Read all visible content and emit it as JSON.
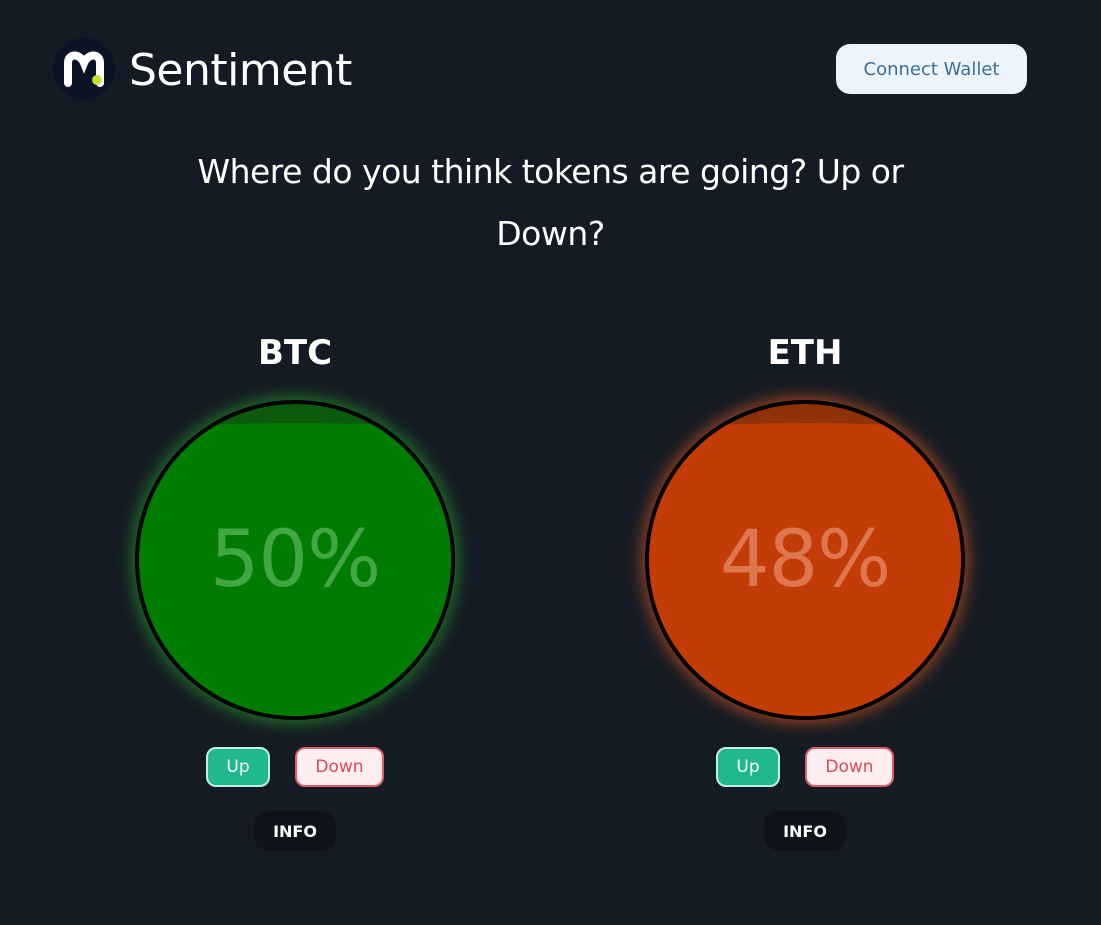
{
  "header": {
    "brand": "Sentiment",
    "logo_icon": "m-logo-icon",
    "connect_wallet_label": "Connect Wallet"
  },
  "question": "Where do you think tokens are going? Up or Down?",
  "tokens": [
    {
      "symbol": "BTC",
      "percent_label": "50%",
      "percent": 50,
      "color": "#007c00",
      "up_label": "Up",
      "down_label": "Down",
      "info_label": "INFO"
    },
    {
      "symbol": "ETH",
      "percent_label": "48%",
      "percent": 48,
      "color": "#c33b07",
      "up_label": "Up",
      "down_label": "Down",
      "info_label": "INFO"
    }
  ],
  "colors": {
    "background": "#151b24",
    "up": "#1fb88f",
    "down": "#e25c6a"
  }
}
